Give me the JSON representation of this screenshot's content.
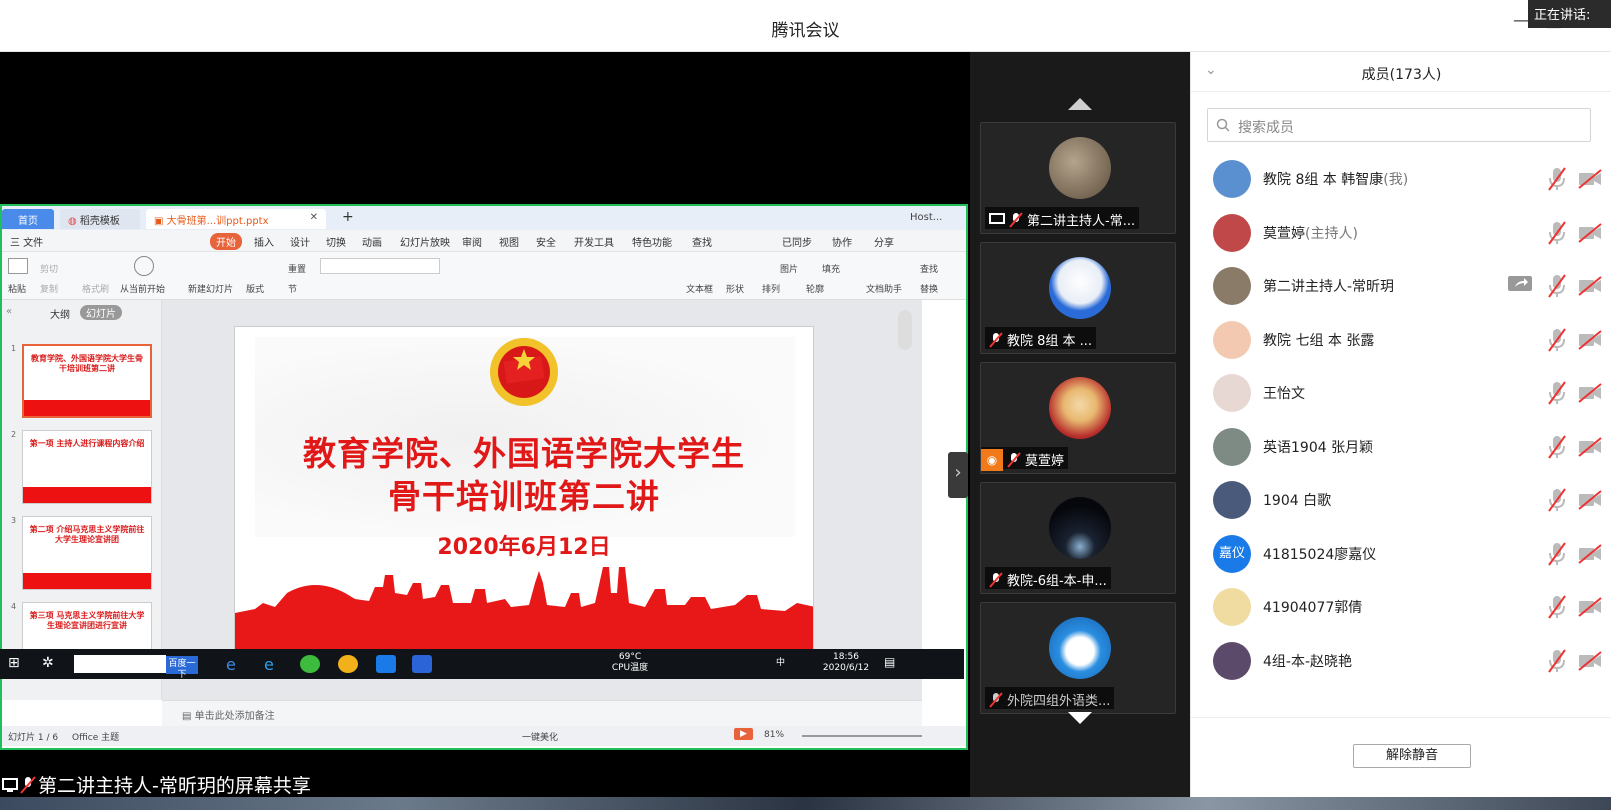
{
  "window": {
    "title": "腾讯会议",
    "speaking_label": "正在讲话:"
  },
  "share": {
    "label": "第二讲主持人-常昕玥的屏幕共享"
  },
  "wps": {
    "tabs": [
      "首页",
      "稻壳模板",
      "大骨班第...训ppt.pptx"
    ],
    "host_label": "Host...",
    "menu": [
      "三 文件",
      "开始",
      "插入",
      "设计",
      "切换",
      "动画",
      "幻灯片放映",
      "审阅",
      "视图",
      "安全",
      "开发工具",
      "特色功能",
      "查找"
    ],
    "menu_right": [
      "已同步",
      "协作",
      "分享"
    ],
    "ribbon": [
      "粘贴",
      "剪切",
      "复制",
      "格式刷",
      "从当前开始",
      "新建幻灯片",
      "版式",
      "节",
      "重置",
      "文本框",
      "形状",
      "排列",
      "轮廓",
      "文档助手",
      "查找",
      "替换",
      "图片",
      "填充"
    ],
    "pane_tabs": [
      "大纲",
      "幻灯片"
    ],
    "thumbs": [
      {
        "num": "1",
        "title": "教育学院、外国语学院大学生骨干培训班第二讲"
      },
      {
        "num": "2",
        "title": "第一项 主持人进行课程内容介绍"
      },
      {
        "num": "3",
        "title": "第二项 介绍马克思主义学院前往大学生理论宣讲团"
      },
      {
        "num": "4",
        "title": "第三项 马克思主义学院前往大学生理论宣讲团进行宣讲"
      }
    ],
    "slide": {
      "title_line1": "教育学院、外国语学院大学生",
      "title_line2": "骨干培训班第二讲",
      "date": "2020年6月12日"
    },
    "notes_placeholder": "单击此处添加备注",
    "status": {
      "slide_count": "幻灯片 1 / 6",
      "theme": "Office 主题",
      "beautify": "一键美化",
      "zoom": "81%"
    },
    "taskbar": {
      "search_text": "百度一下",
      "temp": "69°C",
      "temp_label": "CPU温度",
      "time": "18:56",
      "date": "2020/6/12",
      "ime": "中"
    }
  },
  "video_tiles": [
    {
      "name": "第二讲主持人-常...",
      "avatar": "cats-avatar"
    },
    {
      "name": "教院  8组  本 ...",
      "avatar": "sans-avatar"
    },
    {
      "name": "莫萱婷",
      "avatar": "anime-girl-avatar"
    },
    {
      "name": "教院-6组-本-申...",
      "avatar": "night-sky-avatar"
    },
    {
      "name": "外院四组外语类...",
      "avatar": "doraemon-avatar"
    }
  ],
  "members": {
    "header": "成员(173人)",
    "search_placeholder": "搜索成员",
    "list": [
      {
        "name": "教院  8组  本 韩智康",
        "tag": "(我)",
        "avatar_color": "#5a8fd0"
      },
      {
        "name": "莫萱婷",
        "tag": "(主持人)",
        "avatar_color": "#c04848"
      },
      {
        "name": "第二讲主持人-常昕玥",
        "tag": "",
        "avatar_color": "#8a7a68",
        "sharing": true
      },
      {
        "name": " 教院 七组 本 张露",
        "tag": "",
        "avatar_color": "#f3c9b2"
      },
      {
        "name": " 王怡文",
        "tag": "",
        "avatar_color": "#e8d8d4"
      },
      {
        "name": " 英语1904  张月颖",
        "tag": "",
        "avatar_color": "#7e8b84"
      },
      {
        "name": "1904 白歌",
        "tag": "",
        "avatar_color": "#4a5a7a"
      },
      {
        "name": "41815024廖嘉仪",
        "tag": "",
        "avatar_color": "#1a7ae8",
        "initials": "嘉仪"
      },
      {
        "name": "41904077郭倩",
        "tag": "",
        "avatar_color": "#f0dca0"
      },
      {
        "name": "4组-本-赵晓艳",
        "tag": "",
        "avatar_color": "#5c4a6a"
      }
    ],
    "unmute_all": "解除静音"
  }
}
